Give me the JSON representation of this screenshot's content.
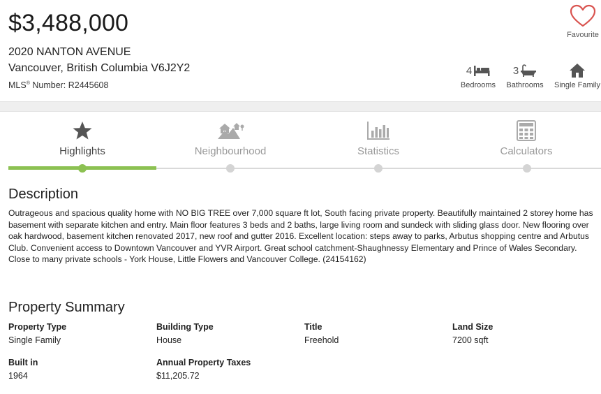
{
  "listing": {
    "price": "$3,488,000",
    "address_line1": "2020 NANTON AVENUE",
    "address_line2": "Vancouver, British Columbia V6J2Y2",
    "mls_label": "MLS",
    "mls_reg": "®",
    "mls_number_text": " Number: R2445608"
  },
  "favourite": {
    "label": "Favourite",
    "icon": "heart-outline-icon",
    "color": "#d9534f"
  },
  "features": {
    "bedrooms": {
      "count": "4",
      "label": "Bedrooms",
      "icon": "bed-icon"
    },
    "bathrooms": {
      "count": "3",
      "label": "Bathrooms",
      "icon": "bathtub-icon"
    },
    "type": {
      "label": "Single Family",
      "icon": "house-icon"
    }
  },
  "tabs": [
    {
      "label": "Highlights",
      "icon": "star-icon",
      "active": true
    },
    {
      "label": "Neighbourhood",
      "icon": "neighbourhood-icon",
      "active": false
    },
    {
      "label": "Statistics",
      "icon": "bar-chart-icon",
      "active": false
    },
    {
      "label": "Calculators",
      "icon": "calculator-icon",
      "active": false
    }
  ],
  "accent_color": "#8cc152",
  "description": {
    "heading": "Description",
    "text": "Outrageous and spacious quality home with NO BIG TREE over 7,000 square ft lot, South facing private property. Beautifully maintained 2 storey home has basement with separate kitchen and entry. Main floor features 3 beds and 2 baths, large living room and sundeck with sliding glass door. New flooring over oak hardwood, basement kitchen renovated 2017, new roof and gutter 2016. Excellent location: steps away to parks, Arbutus shopping centre and Arbutus Club. Convenient access to Downtown Vancouver and YVR Airport. Great school catchment-Shaughnessy Elementary and Prince of Wales Secondary. Close to many private schools - York House, Little Flowers and Vancouver College. (24154162)"
  },
  "summary": {
    "heading": "Property Summary",
    "items": [
      {
        "key": "Property Type",
        "value": "Single Family"
      },
      {
        "key": "Building Type",
        "value": "House"
      },
      {
        "key": "Title",
        "value": "Freehold"
      },
      {
        "key": "Land Size",
        "value": "7200 sqft"
      },
      {
        "key": "Built in",
        "value": "1964"
      },
      {
        "key": "Annual Property Taxes",
        "value": "$11,205.72"
      }
    ]
  }
}
